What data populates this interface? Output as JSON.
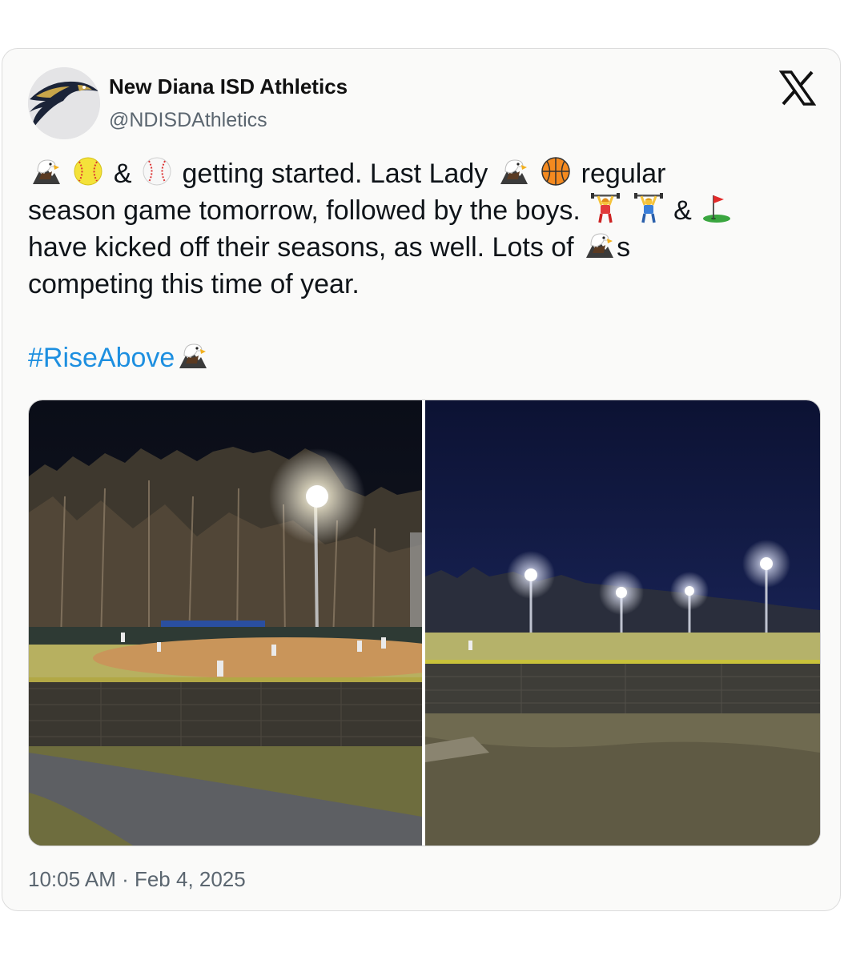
{
  "account": {
    "display_name": "New Diana ISD Athletics",
    "handle": "@NDISDAthletics"
  },
  "tweet": {
    "line1_part1": "getting started. Last Lady",
    "line1_part2": "regular",
    "line2": "season game tomorrow, followed by the boys.",
    "amp": "&",
    "line3_part1": "have kicked off their seasons, as well. Lots of",
    "line3_part2": "s",
    "line4": "competing this time of year.",
    "hashtag": "#RiseAbove",
    "emoji_sequence": [
      "eagle-icon",
      "softball-icon",
      "baseball-icon",
      "eagle-icon",
      "basketball-icon",
      "weightlifter-woman-icon",
      "weightlifter-man-icon",
      "golf-flag-icon",
      "eagle-icon",
      "eagle-icon"
    ]
  },
  "media": {
    "photos": [
      {
        "description": "night-softball-field"
      },
      {
        "description": "night-baseball-outfield"
      }
    ]
  },
  "timestamp": "10:05 AM · Feb 4, 2025",
  "colors": {
    "hashtag": "#1d8fe0",
    "handle": "#5b6670",
    "card_bg": "#fafaf9"
  }
}
